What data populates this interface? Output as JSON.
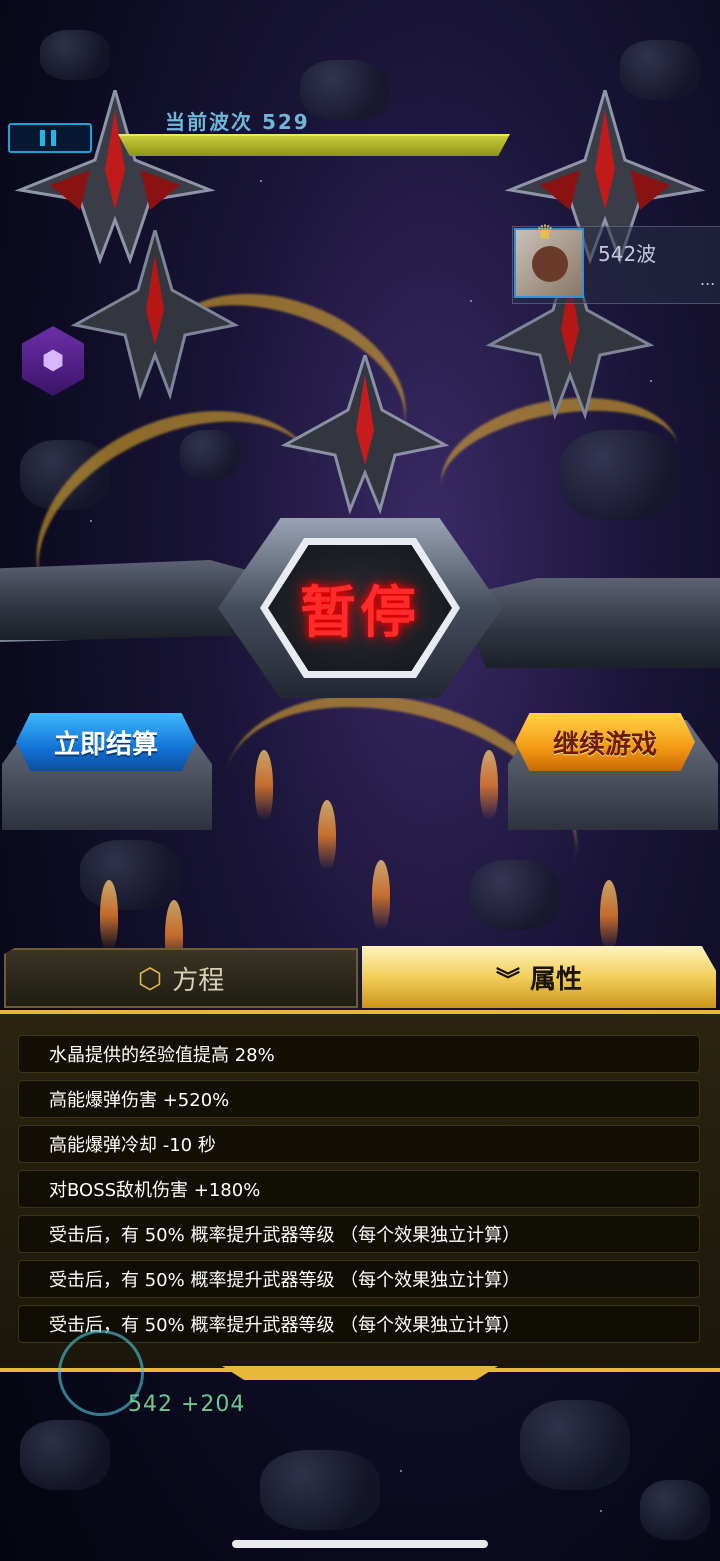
{
  "hud": {
    "wave_label": "当前波次 529",
    "rival_wave": "542波",
    "rival_more": "..."
  },
  "pause": {
    "title": "暂停",
    "settle_button": "立即结算",
    "continue_button": "继续游戏"
  },
  "tabs": [
    {
      "label": "方程",
      "icon": "hex-gear-icon",
      "active": false
    },
    {
      "label": "属性",
      "icon": "double-chevron-down-icon",
      "active": true
    }
  ],
  "attributes": [
    "水晶提供的经验值提高 28%",
    "高能爆弹伤害 +520%",
    "高能爆弹冷却 -10 秒",
    "对BOSS敌机伤害 +180%",
    "受击后，有 50% 概率提升武器等级 （每个效果独立计算）",
    "受击后，有 50% 概率提升武器等级 （每个效果独立计算）",
    "受击后，有 50% 概率提升武器等级 （每个效果独立计算）"
  ],
  "footer": {
    "score": "542 +204"
  },
  "colors": {
    "accent_gold": "#e8b83a",
    "pause_red": "#ff2a2a",
    "settle_blue": "#1273d6",
    "continue_orange": "#f49a14"
  }
}
